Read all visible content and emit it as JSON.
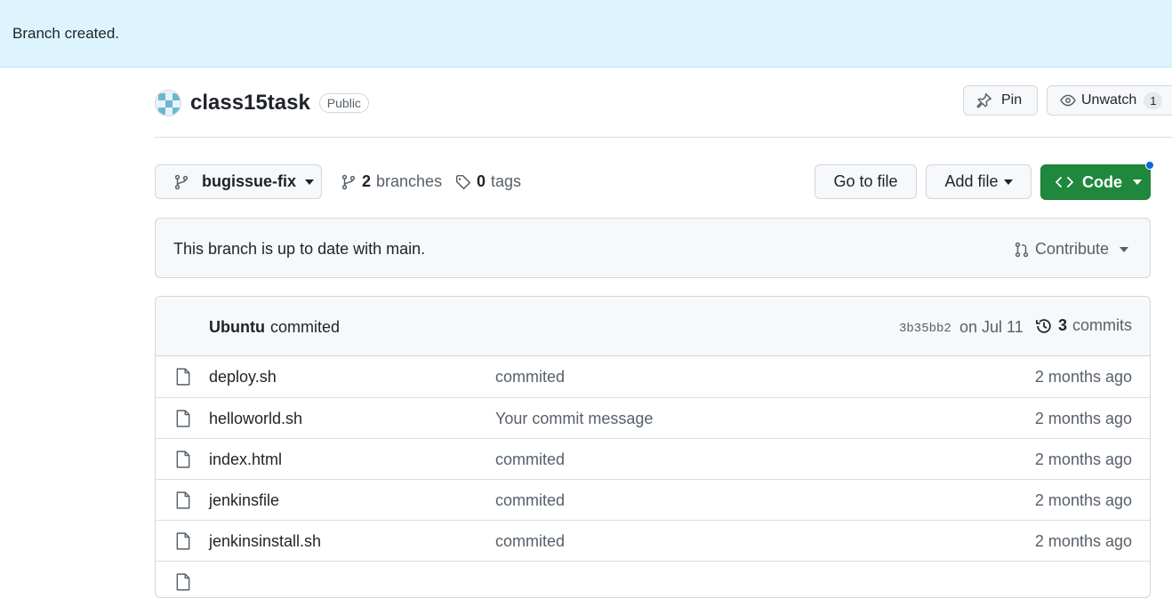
{
  "flash": {
    "message": "Branch created."
  },
  "repo": {
    "name": "class15task",
    "visibility": "Public"
  },
  "header_actions": {
    "pin_label": "Pin",
    "unwatch_label": "Unwatch",
    "watch_count": "1"
  },
  "branch_bar": {
    "current_branch": "bugissue-fix",
    "branches_count": "2",
    "branches_label": "branches",
    "tags_count": "0",
    "tags_label": "tags",
    "go_to_file": "Go to file",
    "add_file": "Add file",
    "code": "Code"
  },
  "status": {
    "message": "This branch is up to date with main.",
    "contribute": "Contribute"
  },
  "latest_commit": {
    "author": "Ubuntu",
    "message": "commited",
    "sha": "3b35bb2",
    "date": "on Jul 11",
    "commit_count": "3",
    "commits_label": "commits"
  },
  "files": [
    {
      "name": "deploy.sh",
      "message": "commited",
      "age": "2 months ago"
    },
    {
      "name": "helloworld.sh",
      "message": "Your commit message",
      "age": "2 months ago"
    },
    {
      "name": "index.html",
      "message": "commited",
      "age": "2 months ago"
    },
    {
      "name": "jenkinsfile",
      "message": "commited",
      "age": "2 months ago"
    },
    {
      "name": "jenkinsinstall.sh",
      "message": "commited",
      "age": "2 months ago"
    }
  ],
  "colors": {
    "primary_green": "#1f883d",
    "flash_bg": "#ddf4ff",
    "notification_dot": "#0969da"
  }
}
